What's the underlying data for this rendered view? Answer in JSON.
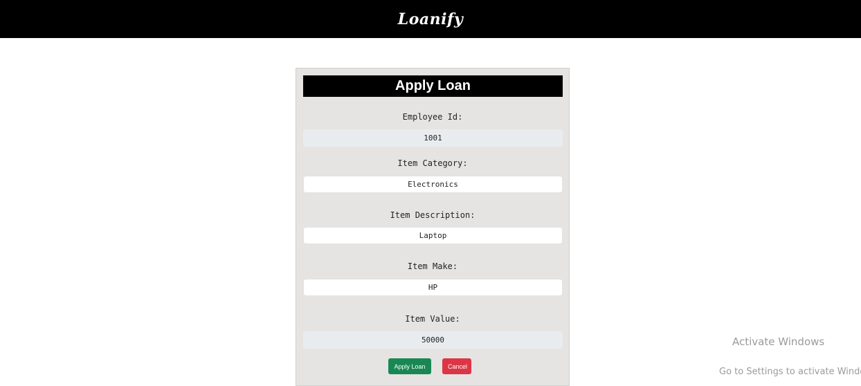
{
  "navbar": {
    "brand": "Loanify"
  },
  "form": {
    "title": "Apply Loan",
    "fields": [
      {
        "label": "Employee Id:",
        "value": "1001"
      },
      {
        "label": "Item Category:",
        "value": "Electronics"
      },
      {
        "label": "Item Description:",
        "value": "Laptop"
      },
      {
        "label": "Item Make:",
        "value": "HP"
      },
      {
        "label": "Item Value:",
        "value": "50000"
      }
    ],
    "apply_label": "Apply Loan",
    "cancel_label": "Cancel"
  },
  "watermark": {
    "line1": "Activate Windows",
    "line2": "Go to Settings to activate Windows."
  }
}
